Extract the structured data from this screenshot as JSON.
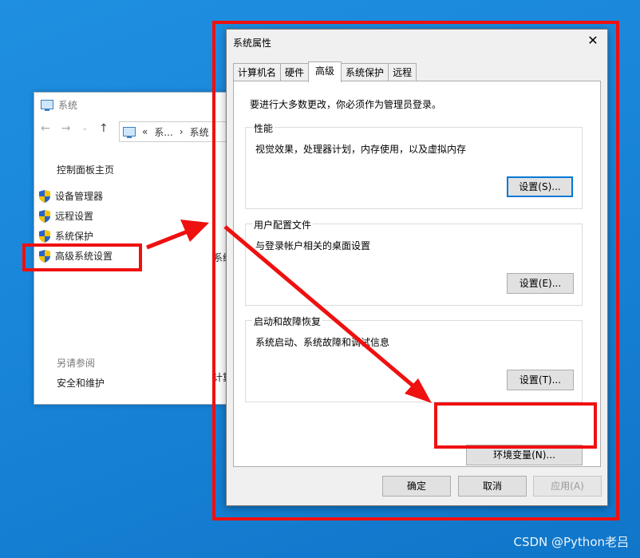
{
  "system_window": {
    "title": "系统",
    "address_sep": "«",
    "address_seg1": "系...",
    "address_sep2": "›",
    "address_seg2": "系统",
    "control_panel_home": "控制面板主页",
    "links": [
      "设备管理器",
      "远程设置",
      "系统保护",
      "高级系统设置"
    ],
    "see_also": "另请参阅",
    "security_link": "安全和维护",
    "fragment_1": "系统",
    "fragment_2": "计算"
  },
  "dialog": {
    "title": "系统属性",
    "tabs": [
      "计算机名",
      "硬件",
      "高级",
      "系统保护",
      "远程"
    ],
    "active_tab": "高级",
    "admin_note": "要进行大多数更改，你必须作为管理员登录。",
    "groups": [
      {
        "legend": "性能",
        "desc": "视觉效果，处理器计划，内存使用，以及虚拟内存",
        "button": "设置(S)..."
      },
      {
        "legend": "用户配置文件",
        "desc": "与登录帐户相关的桌面设置",
        "button": "设置(E)..."
      },
      {
        "legend": "启动和故障恢复",
        "desc": "系统启动、系统故障和调试信息",
        "button": "设置(T)..."
      }
    ],
    "env_button": "环境变量(N)...",
    "ok": "确定",
    "cancel": "取消",
    "apply": "应用(A)"
  },
  "colors": {
    "highlight": "#ef1010",
    "desktop": "#1a86da",
    "focus": "#0078d7"
  },
  "watermark": "CSDN @Python老吕"
}
